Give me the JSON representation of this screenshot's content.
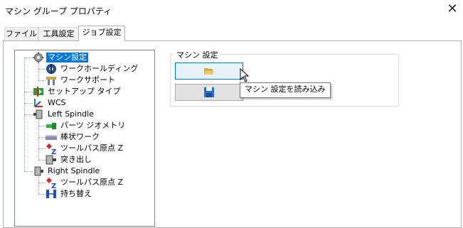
{
  "window": {
    "title": "マシン グループ プロパティ",
    "close_glyph": "✕"
  },
  "tabs": [
    {
      "label": "ファイル",
      "active": false
    },
    {
      "label": "工具設定",
      "active": false
    },
    {
      "label": "ジョブ設定",
      "active": true
    }
  ],
  "tree": {
    "items": [
      {
        "label": "マシン設定",
        "icon": "gear-icon",
        "selected": true
      },
      {
        "label": "ワークホールディング",
        "icon": "workholding-icon"
      },
      {
        "label": "ワークサポート",
        "icon": "worksupport-icon"
      },
      {
        "label": "セットアップ タイプ",
        "icon": "setup-type-icon"
      },
      {
        "label": "WCS",
        "icon": "wcs-axes-icon"
      },
      {
        "label": "Left Spindle",
        "icon": "spindle-icon"
      },
      {
        "label": "パーツ ジオメトリ",
        "icon": "part-geometry-icon"
      },
      {
        "label": "棒状ワーク",
        "icon": "bar-stock-icon"
      },
      {
        "label": "ツールパス原点 Z",
        "icon": "toolpath-origin-icon"
      },
      {
        "label": "突き出し",
        "icon": "stickout-icon"
      },
      {
        "label": "Right Spindle",
        "icon": "spindle-icon"
      },
      {
        "label": "ツールパス原点 Z",
        "icon": "toolpath-origin-icon"
      },
      {
        "label": "持ち替え",
        "icon": "transfer-icon"
      }
    ]
  },
  "machine_settings": {
    "group_title": "マシン 設定",
    "open_button_icon": "folder-open-icon",
    "save_button_icon": "save-icon",
    "tooltip": "マシン 設定を読み込み"
  },
  "colors": {
    "selection": "#0078d7",
    "hover_button": "#e5f1fb",
    "folder": "#d9a93a",
    "save": "#2b6fc2"
  }
}
